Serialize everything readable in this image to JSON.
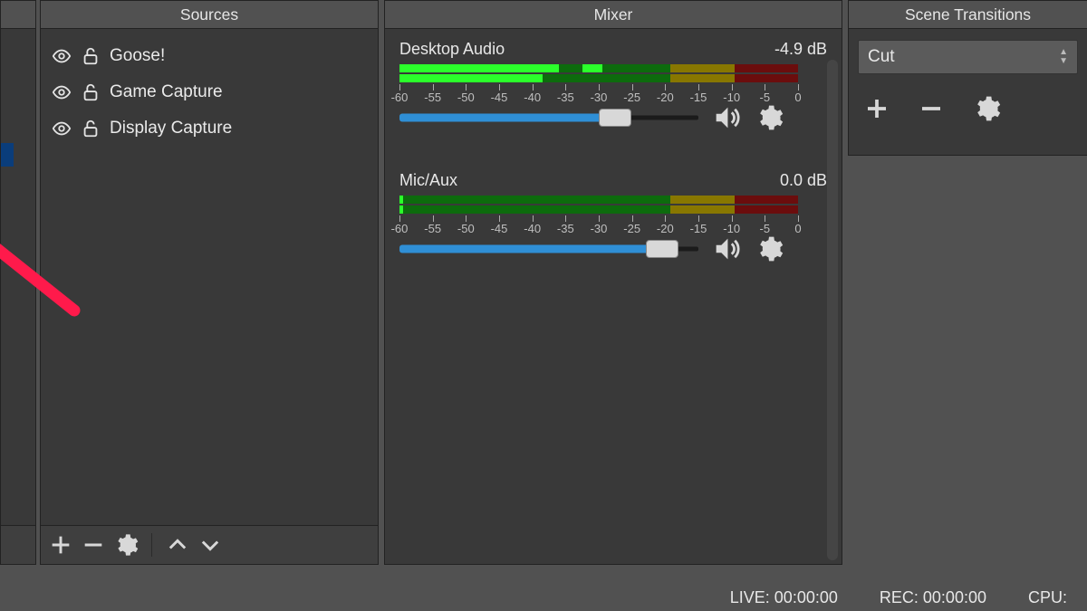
{
  "panels": {
    "sources": {
      "title": "Sources"
    },
    "mixer": {
      "title": "Mixer"
    },
    "trans": {
      "title": "Scene Transitions"
    }
  },
  "sources": {
    "items": [
      {
        "label": "Goose!"
      },
      {
        "label": "Game Capture"
      },
      {
        "label": "Display Capture"
      }
    ]
  },
  "mixer": {
    "ticks": [
      "-60",
      "-55",
      "-50",
      "-45",
      "-40",
      "-35",
      "-30",
      "-25",
      "-20",
      "-15",
      "-10",
      "-5",
      "0"
    ],
    "channels": [
      {
        "name": "Desktop Audio",
        "db": "-4.9 dB",
        "slider": 0.72
      },
      {
        "name": "Mic/Aux",
        "db": "0.0 dB",
        "slider": 0.88
      }
    ]
  },
  "transitions": {
    "selected": "Cut"
  },
  "status": {
    "live_label": "LIVE:",
    "live_time": "00:00:00",
    "rec_label": "REC:",
    "rec_time": "00:00:00",
    "cpu_label": "CPU:"
  }
}
